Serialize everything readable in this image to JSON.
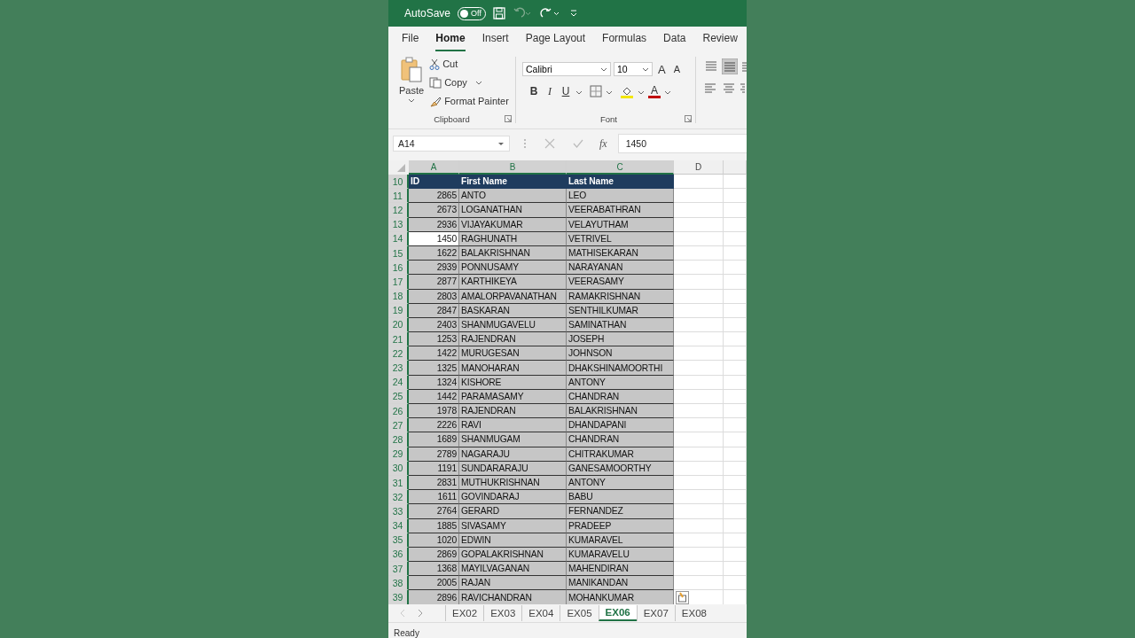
{
  "title_bar": {
    "autosave_label": "AutoSave",
    "autosave_toggle": {
      "label": "Off",
      "on": false
    }
  },
  "ribbon_tabs": [
    {
      "label": "File",
      "selected": false
    },
    {
      "label": "Home",
      "selected": true
    },
    {
      "label": "Insert",
      "selected": false
    },
    {
      "label": "Page Layout",
      "selected": false
    },
    {
      "label": "Formulas",
      "selected": false
    },
    {
      "label": "Data",
      "selected": false
    },
    {
      "label": "Review",
      "selected": false
    }
  ],
  "clipboard": {
    "paste": "Paste",
    "cut": "Cut",
    "copy": "Copy",
    "format_painter": "Format Painter",
    "label": "Clipboard"
  },
  "font": {
    "name": "Calibri",
    "size": "10",
    "grow": "A",
    "shrink": "A",
    "bold": "B",
    "italic": "I",
    "underline": "U",
    "font_color": "A",
    "label": "Font"
  },
  "formula_bar": {
    "name_box": "A14",
    "function_button": "fx",
    "value": "1450"
  },
  "columns": [
    {
      "label": "A",
      "selected": true
    },
    {
      "label": "B",
      "selected": true
    },
    {
      "label": "C",
      "selected": true
    },
    {
      "label": "D",
      "selected": false
    }
  ],
  "header_row": {
    "number": "10",
    "cells": [
      "ID",
      "First Name",
      "Last Name"
    ]
  },
  "rows": [
    {
      "number": "11",
      "cells": [
        "2865",
        "ANTO",
        "LEO"
      ],
      "selected": true,
      "active": false
    },
    {
      "number": "12",
      "cells": [
        "2673",
        "LOGANATHAN",
        "VEERABATHRAN"
      ],
      "selected": true,
      "active": false
    },
    {
      "number": "13",
      "cells": [
        "2936",
        "VIJAYAKUMAR",
        "VELAYUTHAM"
      ],
      "selected": true,
      "active": false
    },
    {
      "number": "14",
      "cells": [
        "1450",
        "RAGHUNATH",
        "VETRIVEL"
      ],
      "selected": true,
      "active": true
    },
    {
      "number": "15",
      "cells": [
        "1622",
        "BALAKRISHNAN",
        "MATHISEKARAN"
      ],
      "selected": true,
      "active": false
    },
    {
      "number": "16",
      "cells": [
        "2939",
        "PONNUSAMY",
        "NARAYANAN"
      ],
      "selected": true,
      "active": false
    },
    {
      "number": "17",
      "cells": [
        "2877",
        "KARTHIKEYA",
        "VEERASAMY"
      ],
      "selected": true,
      "active": false
    },
    {
      "number": "18",
      "cells": [
        "2803",
        "AMALORPAVANATHAN",
        "RAMAKRISHNAN"
      ],
      "selected": true,
      "active": false
    },
    {
      "number": "19",
      "cells": [
        "2847",
        "BASKARAN",
        "SENTHILKUMAR"
      ],
      "selected": true,
      "active": false
    },
    {
      "number": "20",
      "cells": [
        "2403",
        "SHANMUGAVELU",
        "SAMINATHAN"
      ],
      "selected": true,
      "active": false
    },
    {
      "number": "21",
      "cells": [
        "1253",
        "RAJENDRAN",
        "JOSEPH"
      ],
      "selected": true,
      "active": false
    },
    {
      "number": "22",
      "cells": [
        "1422",
        "MURUGESAN",
        "JOHNSON"
      ],
      "selected": true,
      "active": false
    },
    {
      "number": "23",
      "cells": [
        "1325",
        "MANOHARAN",
        "DHAKSHINAMOORTHI"
      ],
      "selected": true,
      "active": false
    },
    {
      "number": "24",
      "cells": [
        "1324",
        "KISHORE",
        "ANTONY"
      ],
      "selected": true,
      "active": false
    },
    {
      "number": "25",
      "cells": [
        "1442",
        "PARAMASAMY",
        "CHANDRAN"
      ],
      "selected": true,
      "active": false
    },
    {
      "number": "26",
      "cells": [
        "1978",
        "RAJENDRAN",
        "BALAKRISHNAN"
      ],
      "selected": true,
      "active": false
    },
    {
      "number": "27",
      "cells": [
        "2226",
        "RAVI",
        "DHANDAPANI"
      ],
      "selected": true,
      "active": false
    },
    {
      "number": "28",
      "cells": [
        "1689",
        "SHANMUGAM",
        "CHANDRAN"
      ],
      "selected": true,
      "active": false
    },
    {
      "number": "29",
      "cells": [
        "2789",
        "NAGARAJU",
        "CHITRAKUMAR"
      ],
      "selected": true,
      "active": false
    },
    {
      "number": "30",
      "cells": [
        "1191",
        "SUNDARARAJU",
        "GANESAMOORTHY"
      ],
      "selected": true,
      "active": false
    },
    {
      "number": "31",
      "cells": [
        "2831",
        "MUTHUKRISHNAN",
        "ANTONY"
      ],
      "selected": true,
      "active": false
    },
    {
      "number": "32",
      "cells": [
        "1611",
        "GOVINDARAJ",
        "BABU"
      ],
      "selected": true,
      "active": false
    },
    {
      "number": "33",
      "cells": [
        "2764",
        "GERARD",
        "FERNANDEZ"
      ],
      "selected": true,
      "active": false
    },
    {
      "number": "34",
      "cells": [
        "1885",
        "SIVASAMY",
        "PRADEEP"
      ],
      "selected": true,
      "active": false
    },
    {
      "number": "35",
      "cells": [
        "1020",
        "EDWIN",
        "KUMARAVEL"
      ],
      "selected": true,
      "active": false
    },
    {
      "number": "36",
      "cells": [
        "2869",
        "GOPALAKRISHNAN",
        "KUMARAVELU"
      ],
      "selected": true,
      "active": false
    },
    {
      "number": "37",
      "cells": [
        "1368",
        "MAYILVAGANAN",
        "MAHENDIRAN"
      ],
      "selected": true,
      "active": false
    },
    {
      "number": "38",
      "cells": [
        "2005",
        "RAJAN",
        "MANIKANDAN"
      ],
      "selected": true,
      "active": false
    },
    {
      "number": "39",
      "cells": [
        "2896",
        "RAVICHANDRAN",
        "MOHANKUMAR"
      ],
      "selected": true,
      "active": false
    }
  ],
  "sheet_tabs": [
    {
      "label": "EX02",
      "selected": false
    },
    {
      "label": "EX03",
      "selected": false
    },
    {
      "label": "EX04",
      "selected": false
    },
    {
      "label": "EX05",
      "selected": false
    },
    {
      "label": "EX06",
      "selected": true
    },
    {
      "label": "EX07",
      "selected": false
    },
    {
      "label": "EX08",
      "selected": false
    }
  ],
  "status_bar": {
    "text": "Ready"
  }
}
